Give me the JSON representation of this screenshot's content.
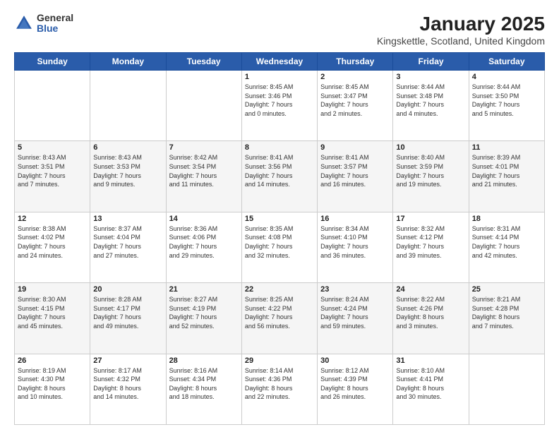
{
  "logo": {
    "general": "General",
    "blue": "Blue"
  },
  "title": "January 2025",
  "subtitle": "Kingskettle, Scotland, United Kingdom",
  "weekdays": [
    "Sunday",
    "Monday",
    "Tuesday",
    "Wednesday",
    "Thursday",
    "Friday",
    "Saturday"
  ],
  "weeks": [
    [
      {
        "day": "",
        "info": ""
      },
      {
        "day": "",
        "info": ""
      },
      {
        "day": "",
        "info": ""
      },
      {
        "day": "1",
        "info": "Sunrise: 8:45 AM\nSunset: 3:46 PM\nDaylight: 7 hours\nand 0 minutes."
      },
      {
        "day": "2",
        "info": "Sunrise: 8:45 AM\nSunset: 3:47 PM\nDaylight: 7 hours\nand 2 minutes."
      },
      {
        "day": "3",
        "info": "Sunrise: 8:44 AM\nSunset: 3:48 PM\nDaylight: 7 hours\nand 4 minutes."
      },
      {
        "day": "4",
        "info": "Sunrise: 8:44 AM\nSunset: 3:50 PM\nDaylight: 7 hours\nand 5 minutes."
      }
    ],
    [
      {
        "day": "5",
        "info": "Sunrise: 8:43 AM\nSunset: 3:51 PM\nDaylight: 7 hours\nand 7 minutes."
      },
      {
        "day": "6",
        "info": "Sunrise: 8:43 AM\nSunset: 3:53 PM\nDaylight: 7 hours\nand 9 minutes."
      },
      {
        "day": "7",
        "info": "Sunrise: 8:42 AM\nSunset: 3:54 PM\nDaylight: 7 hours\nand 11 minutes."
      },
      {
        "day": "8",
        "info": "Sunrise: 8:41 AM\nSunset: 3:56 PM\nDaylight: 7 hours\nand 14 minutes."
      },
      {
        "day": "9",
        "info": "Sunrise: 8:41 AM\nSunset: 3:57 PM\nDaylight: 7 hours\nand 16 minutes."
      },
      {
        "day": "10",
        "info": "Sunrise: 8:40 AM\nSunset: 3:59 PM\nDaylight: 7 hours\nand 19 minutes."
      },
      {
        "day": "11",
        "info": "Sunrise: 8:39 AM\nSunset: 4:01 PM\nDaylight: 7 hours\nand 21 minutes."
      }
    ],
    [
      {
        "day": "12",
        "info": "Sunrise: 8:38 AM\nSunset: 4:02 PM\nDaylight: 7 hours\nand 24 minutes."
      },
      {
        "day": "13",
        "info": "Sunrise: 8:37 AM\nSunset: 4:04 PM\nDaylight: 7 hours\nand 27 minutes."
      },
      {
        "day": "14",
        "info": "Sunrise: 8:36 AM\nSunset: 4:06 PM\nDaylight: 7 hours\nand 29 minutes."
      },
      {
        "day": "15",
        "info": "Sunrise: 8:35 AM\nSunset: 4:08 PM\nDaylight: 7 hours\nand 32 minutes."
      },
      {
        "day": "16",
        "info": "Sunrise: 8:34 AM\nSunset: 4:10 PM\nDaylight: 7 hours\nand 36 minutes."
      },
      {
        "day": "17",
        "info": "Sunrise: 8:32 AM\nSunset: 4:12 PM\nDaylight: 7 hours\nand 39 minutes."
      },
      {
        "day": "18",
        "info": "Sunrise: 8:31 AM\nSunset: 4:14 PM\nDaylight: 7 hours\nand 42 minutes."
      }
    ],
    [
      {
        "day": "19",
        "info": "Sunrise: 8:30 AM\nSunset: 4:15 PM\nDaylight: 7 hours\nand 45 minutes."
      },
      {
        "day": "20",
        "info": "Sunrise: 8:28 AM\nSunset: 4:17 PM\nDaylight: 7 hours\nand 49 minutes."
      },
      {
        "day": "21",
        "info": "Sunrise: 8:27 AM\nSunset: 4:19 PM\nDaylight: 7 hours\nand 52 minutes."
      },
      {
        "day": "22",
        "info": "Sunrise: 8:25 AM\nSunset: 4:22 PM\nDaylight: 7 hours\nand 56 minutes."
      },
      {
        "day": "23",
        "info": "Sunrise: 8:24 AM\nSunset: 4:24 PM\nDaylight: 7 hours\nand 59 minutes."
      },
      {
        "day": "24",
        "info": "Sunrise: 8:22 AM\nSunset: 4:26 PM\nDaylight: 8 hours\nand 3 minutes."
      },
      {
        "day": "25",
        "info": "Sunrise: 8:21 AM\nSunset: 4:28 PM\nDaylight: 8 hours\nand 7 minutes."
      }
    ],
    [
      {
        "day": "26",
        "info": "Sunrise: 8:19 AM\nSunset: 4:30 PM\nDaylight: 8 hours\nand 10 minutes."
      },
      {
        "day": "27",
        "info": "Sunrise: 8:17 AM\nSunset: 4:32 PM\nDaylight: 8 hours\nand 14 minutes."
      },
      {
        "day": "28",
        "info": "Sunrise: 8:16 AM\nSunset: 4:34 PM\nDaylight: 8 hours\nand 18 minutes."
      },
      {
        "day": "29",
        "info": "Sunrise: 8:14 AM\nSunset: 4:36 PM\nDaylight: 8 hours\nand 22 minutes."
      },
      {
        "day": "30",
        "info": "Sunrise: 8:12 AM\nSunset: 4:39 PM\nDaylight: 8 hours\nand 26 minutes."
      },
      {
        "day": "31",
        "info": "Sunrise: 8:10 AM\nSunset: 4:41 PM\nDaylight: 8 hours\nand 30 minutes."
      },
      {
        "day": "",
        "info": ""
      }
    ]
  ]
}
